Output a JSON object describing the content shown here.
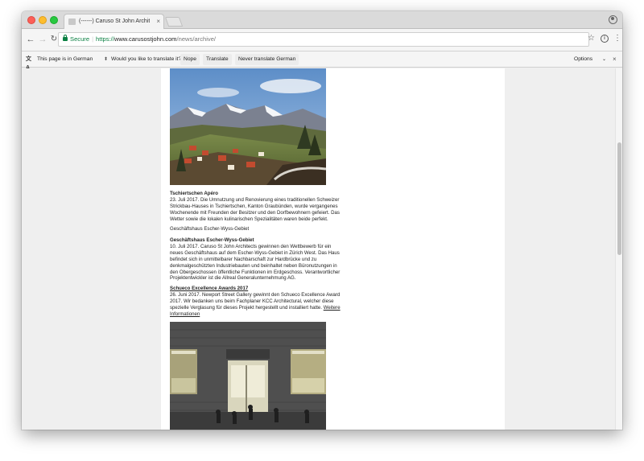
{
  "browser": {
    "tab_title": "(------) Caruso St John Archit",
    "url_security_label": "Secure",
    "url_scheme": "https://",
    "url_host": "www.carusostjohn.com",
    "url_path": "/news/archive/"
  },
  "translate_bar": {
    "page_is_in": "This page is in",
    "language": "German",
    "question": "Would you like to translate it?",
    "nope": "Nope",
    "translate": "Translate",
    "never": "Never translate German",
    "options": "Options"
  },
  "articles": [
    {
      "title": "Tschiertschen Apéro",
      "date": "23. Juli 2017.",
      "body": "Die Umnutzung und Renovierung eines traditionellen Schweizer Strickbau-Hauses in Tschiertschen, Kanton Graubünden, wurde vergangenes Wochenende mit Freunden der Besitzer und den Dorfbewohnern gefeiert. Das Wetter sowie die lokalen kulinarischen Spezialitäten waren beide perfekt."
    },
    {
      "title": "Geschäftshaus Escher-Wyss-Gebiet",
      "date": "10. Juli 2017.",
      "body": "Caruso St John Architects gewinnen den Wettbewerb für ein neues Geschäftshaus auf dem Escher-Wyss-Gebiet in Zürich West. Das Haus befindet sich in unmittelbarer Nachbarschaft zur Hardbrücke und zu denkmalgeschützten Industriebauten und beinhaltet neben Büronutzungen in den Obergeschossen öffentliche Funktionen im Erdgeschoss. Verantwortlicher Projektentwickler ist die Allreal Generalunternehmung AG."
    },
    {
      "title": "Schueco Excellence Awards 2017",
      "date": "26. Juni 2017.",
      "body": "Newport Street Gallery gewinnt den Schueco Excellence Award 2017. Wir bedanken uns beim Fachplaner KCC Architectural, welcher diese spezielle Verglasung für dieses Projekt hergestellt und installiert hatte.",
      "link": "Weitere Informationen"
    }
  ],
  "plain_heading": "Geschäftshaus Escher-Wyss-Gebiet",
  "icons": {
    "back": "←",
    "forward": "→",
    "reload": "↻",
    "star": "☆",
    "info": "i",
    "menu": "⋮",
    "close": "×",
    "chevron": "⌄",
    "translate": "文A"
  },
  "colors": {
    "secure_green": "#0b8043",
    "viewport_gray": "#efefef"
  }
}
